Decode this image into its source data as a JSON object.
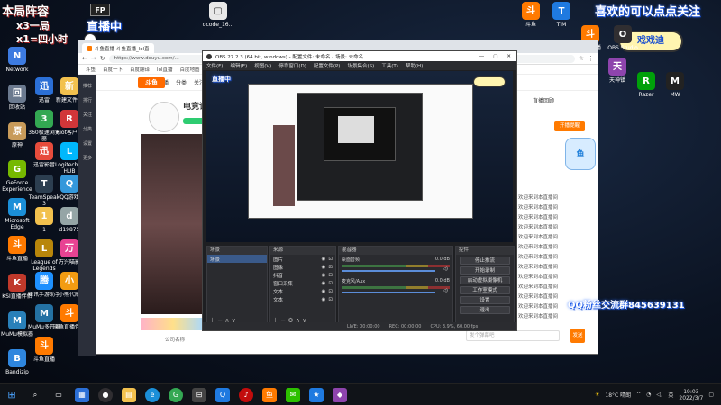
{
  "overlay": {
    "top_left_title": "本局阵容",
    "score_line1": "x3一局",
    "score_line2": "x1=四小时",
    "stream_label": "直播中",
    "follow_text": "喜欢的可以点点关注",
    "streamer_tag": "戏戏迪",
    "qq_group": "QQ粉丝交流群845639131"
  },
  "desktop": {
    "left_icons": [
      {
        "label": "Network",
        "icon": "network-icon",
        "color": "#3d7be0"
      },
      {
        "label": "回收站",
        "icon": "recycle-bin-icon",
        "color": "#6b7a8f"
      },
      {
        "label": "原神",
        "icon": "genshin-icon",
        "color": "#c89b5a"
      },
      {
        "label": "GeForce Experience",
        "icon": "geforce-icon",
        "color": "#76b900"
      },
      {
        "label": "Microsoft Edge",
        "icon": "edge-icon",
        "color": "#1b8fd8"
      },
      {
        "label": "斗鱼直播",
        "icon": "douyu-icon",
        "color": "#ff7a00"
      },
      {
        "label": "KSI直播伴侣",
        "icon": "ksi-icon",
        "color": "#c0392b"
      },
      {
        "label": "MuMu模拟器",
        "icon": "mumu-icon",
        "color": "#2980b9"
      },
      {
        "label": "Bandizip",
        "icon": "bandizip-icon",
        "color": "#2e86de"
      }
    ],
    "col2_icons": [
      {
        "label": "迅雷",
        "icon": "xunlei-icon",
        "color": "#2b6fd6"
      },
      {
        "label": "360极速浏览器",
        "icon": "360-browser-icon",
        "color": "#33a852"
      },
      {
        "label": "迅雷影音",
        "icon": "video-player-icon",
        "color": "#e74c3c"
      },
      {
        "label": "TeamSpeak 3",
        "icon": "teamspeak-icon",
        "color": "#2c3e50"
      },
      {
        "label": "1",
        "icon": "folder-icon",
        "color": "#f2c14e"
      },
      {
        "label": "League of Legends",
        "icon": "lol-icon",
        "color": "#b8860b"
      },
      {
        "label": "腾讯手游助手",
        "icon": "tencent-icon",
        "color": "#1e90ff"
      },
      {
        "label": "MuMu多开器",
        "icon": "mumu-multi-icon",
        "color": "#2471a3"
      },
      {
        "label": "斗鱼直播",
        "icon": "douyu-icon",
        "color": "#ff7a00"
      }
    ],
    "col3_icons": [
      {
        "label": "新建文件夹",
        "icon": "folder-icon",
        "color": "#f2c14e"
      },
      {
        "label": "Riot客户端",
        "icon": "riot-icon",
        "color": "#d13639"
      },
      {
        "label": "Logitech G HUB",
        "icon": "logitech-icon",
        "color": "#00b8fc"
      },
      {
        "label": "QQ游戏",
        "icon": "qq-game-icon",
        "color": "#3498db"
      },
      {
        "label": "d19875",
        "icon": "file-icon",
        "color": "#95a5a6"
      },
      {
        "label": "万兴喵影",
        "icon": "editor-icon",
        "color": "#e84393"
      },
      {
        "label": "小熊代刷",
        "icon": "bear-icon",
        "color": "#f39c12"
      },
      {
        "label": "斗鱼直播伴侣",
        "icon": "douyu-icon",
        "color": "#ff7a00"
      }
    ],
    "right_icons": [
      {
        "label": "斗鱼",
        "icon": "douyu-icon",
        "color": "#ff7a00"
      },
      {
        "label": "TIM",
        "icon": "tim-icon",
        "color": "#1f7ae0"
      },
      {
        "label": "斗鱼直播",
        "icon": "douyu-icon",
        "color": "#ff7a00"
      },
      {
        "label": "OBS Studio",
        "icon": "obs-icon",
        "color": "#302e31"
      },
      {
        "label": "天神镇",
        "icon": "game-icon",
        "color": "#8e44ad"
      },
      {
        "label": "Razer",
        "icon": "razer-icon",
        "color": "#00a00a"
      },
      {
        "label": "MW",
        "icon": "mw-icon",
        "color": "#222"
      }
    ],
    "top_icon_label": "qcode_16..."
  },
  "browser": {
    "tab_title": "斗鱼直播-斗鱼直播_lol直播间",
    "url": "https://www.douyu.com/...",
    "bookmarks": [
      "斗鱼",
      "百度一下",
      "百度翻译",
      "lol直播",
      "百度地图"
    ],
    "site_nav": [
      "首页",
      "直播",
      "分类",
      "关注"
    ],
    "site_logo": "斗鱼",
    "streamer_name": "电竞许",
    "chat_title": "直播回顾",
    "follow_btn": "开播提醒",
    "chat_lines": [
      "欢迎来到本直播间",
      "欢迎来到本直播间",
      "欢迎来到本直播间",
      "欢迎来到本直播间",
      "欢迎来到本直播间",
      "欢迎来到本直播间",
      "欢迎来到本直播间",
      "欢迎来到本直播间",
      "欢迎来到本直播间",
      "欢迎来到本直播间",
      "欢迎来到本直播间",
      "欢迎来到本直播间",
      "欢迎来到本直播间"
    ],
    "chat_input_placeholder": "发个弹幕吧",
    "send_btn": "发送",
    "bottom_text": "公司名称",
    "sidebar": [
      "推荐",
      "排行",
      "关注",
      "分类",
      "设置",
      "更多"
    ]
  },
  "obs": {
    "title": "OBS 27.2.3 (64 bit, windows) - 配置文件: 未命名 - 场景: 未命名",
    "menus": [
      "文件(F)",
      "编辑(E)",
      "视图(V)",
      "停靠窗口(D)",
      "配置文件(P)",
      "场景集合(S)",
      "工具(T)",
      "帮助(H)"
    ],
    "scene_header": "场景",
    "source_header": "来源",
    "mixer_header": "混音器",
    "controls_header": "控件",
    "scene_name": "场景",
    "sources": [
      "图片",
      "图像",
      "抖音",
      "窗口采集",
      "文本",
      "文本"
    ],
    "mixer_tracks": [
      {
        "name": "桌面音频",
        "db": "0.0 dB"
      },
      {
        "name": "麦克风/Aux",
        "db": "0.0 dB"
      }
    ],
    "controls": [
      "停止推流",
      "开始录制",
      "启动虚拟摄像机",
      "工作室模式",
      "设置",
      "退出"
    ],
    "status": {
      "live": "LIVE: 00:00:00",
      "rec": "REC: 00:00:00",
      "cpu": "CPU: 3.9%, 60.00 fps"
    }
  },
  "taskbar": {
    "weather": "18°C 晴朗",
    "time": "19:03",
    "date": "2022/3/7",
    "lang": "英"
  }
}
